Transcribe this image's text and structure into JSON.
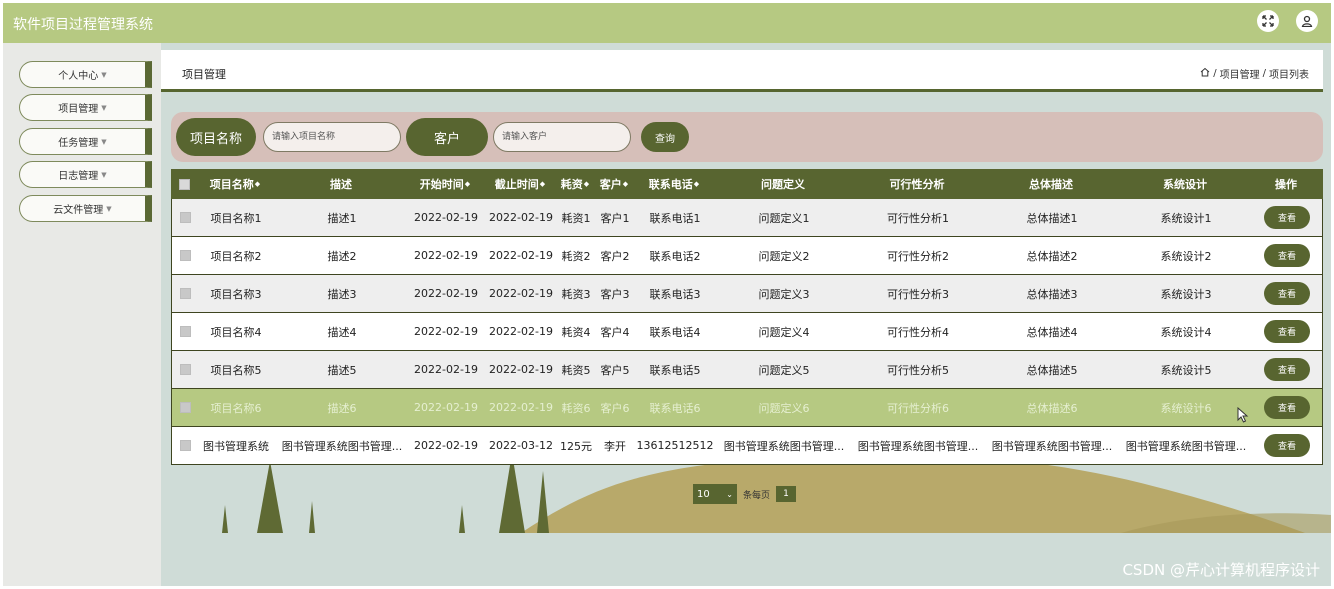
{
  "app": {
    "title": "软件项目过程管理系统"
  },
  "topbar": {
    "icons": [
      "fullscreen-icon",
      "user-icon"
    ]
  },
  "sidebar": {
    "items": [
      {
        "label": "个人中心"
      },
      {
        "label": "项目管理"
      },
      {
        "label": "任务管理"
      },
      {
        "label": "日志管理"
      },
      {
        "label": "云文件管理"
      }
    ]
  },
  "breadcrumb": {
    "page_title": "项目管理",
    "path": [
      "项目管理",
      "项目列表"
    ],
    "separator": "/"
  },
  "search": {
    "name_label": "项目名称",
    "name_placeholder": "请输入项目名称",
    "client_label": "客户",
    "client_placeholder": "请输入客户",
    "query_button": "查询"
  },
  "table": {
    "headers": {
      "name": "项目名称",
      "desc": "描述",
      "start": "开始时间",
      "end": "截止时间",
      "cost": "耗资",
      "client": "客户",
      "phone": "联系电话",
      "problem": "问题定义",
      "feasibility": "可行性分析",
      "overall": "总体描述",
      "design": "系统设计",
      "actions": "操作"
    },
    "view_label": "查看",
    "rows": [
      {
        "name": "项目名称1",
        "desc": "描述1",
        "start": "2022-02-19",
        "end": "2022-02-19",
        "cost": "耗资1",
        "client": "客户1",
        "phone": "联系电话1",
        "problem": "问题定义1",
        "feasibility": "可行性分析1",
        "overall": "总体描述1",
        "design": "系统设计1"
      },
      {
        "name": "项目名称2",
        "desc": "描述2",
        "start": "2022-02-19",
        "end": "2022-02-19",
        "cost": "耗资2",
        "client": "客户2",
        "phone": "联系电话2",
        "problem": "问题定义2",
        "feasibility": "可行性分析2",
        "overall": "总体描述2",
        "design": "系统设计2"
      },
      {
        "name": "项目名称3",
        "desc": "描述3",
        "start": "2022-02-19",
        "end": "2022-02-19",
        "cost": "耗资3",
        "client": "客户3",
        "phone": "联系电话3",
        "problem": "问题定义3",
        "feasibility": "可行性分析3",
        "overall": "总体描述3",
        "design": "系统设计3"
      },
      {
        "name": "项目名称4",
        "desc": "描述4",
        "start": "2022-02-19",
        "end": "2022-02-19",
        "cost": "耗资4",
        "client": "客户4",
        "phone": "联系电话4",
        "problem": "问题定义4",
        "feasibility": "可行性分析4",
        "overall": "总体描述4",
        "design": "系统设计4"
      },
      {
        "name": "项目名称5",
        "desc": "描述5",
        "start": "2022-02-19",
        "end": "2022-02-19",
        "cost": "耗资5",
        "client": "客户5",
        "phone": "联系电话5",
        "problem": "问题定义5",
        "feasibility": "可行性分析5",
        "overall": "总体描述5",
        "design": "系统设计5"
      },
      {
        "name": "项目名称6",
        "desc": "描述6",
        "start": "2022-02-19",
        "end": "2022-02-19",
        "cost": "耗资6",
        "client": "客户6",
        "phone": "联系电话6",
        "problem": "问题定义6",
        "feasibility": "可行性分析6",
        "overall": "总体描述6",
        "design": "系统设计6"
      },
      {
        "name": "图书管理系统",
        "desc": "图书管理系统图书管理...",
        "start": "2022-02-19",
        "end": "2022-03-12",
        "cost": "125元",
        "client": "李开",
        "phone": "13612512512",
        "problem": "图书管理系统图书管理...",
        "feasibility": "图书管理系统图书管理...",
        "overall": "图书管理系统图书管理...",
        "design": "图书管理系统图书管理..."
      }
    ]
  },
  "pagination": {
    "page_size": "10",
    "per_page_label": "条每页",
    "current_page": "1"
  },
  "watermark": "CSDN @芹心计算机程序设计",
  "colors": {
    "topbar": "#b6c982",
    "accent": "#586530",
    "search_bg": "#d6bfb9",
    "content_bg": "#cfdcd7",
    "hover_row": "#b6c982"
  }
}
